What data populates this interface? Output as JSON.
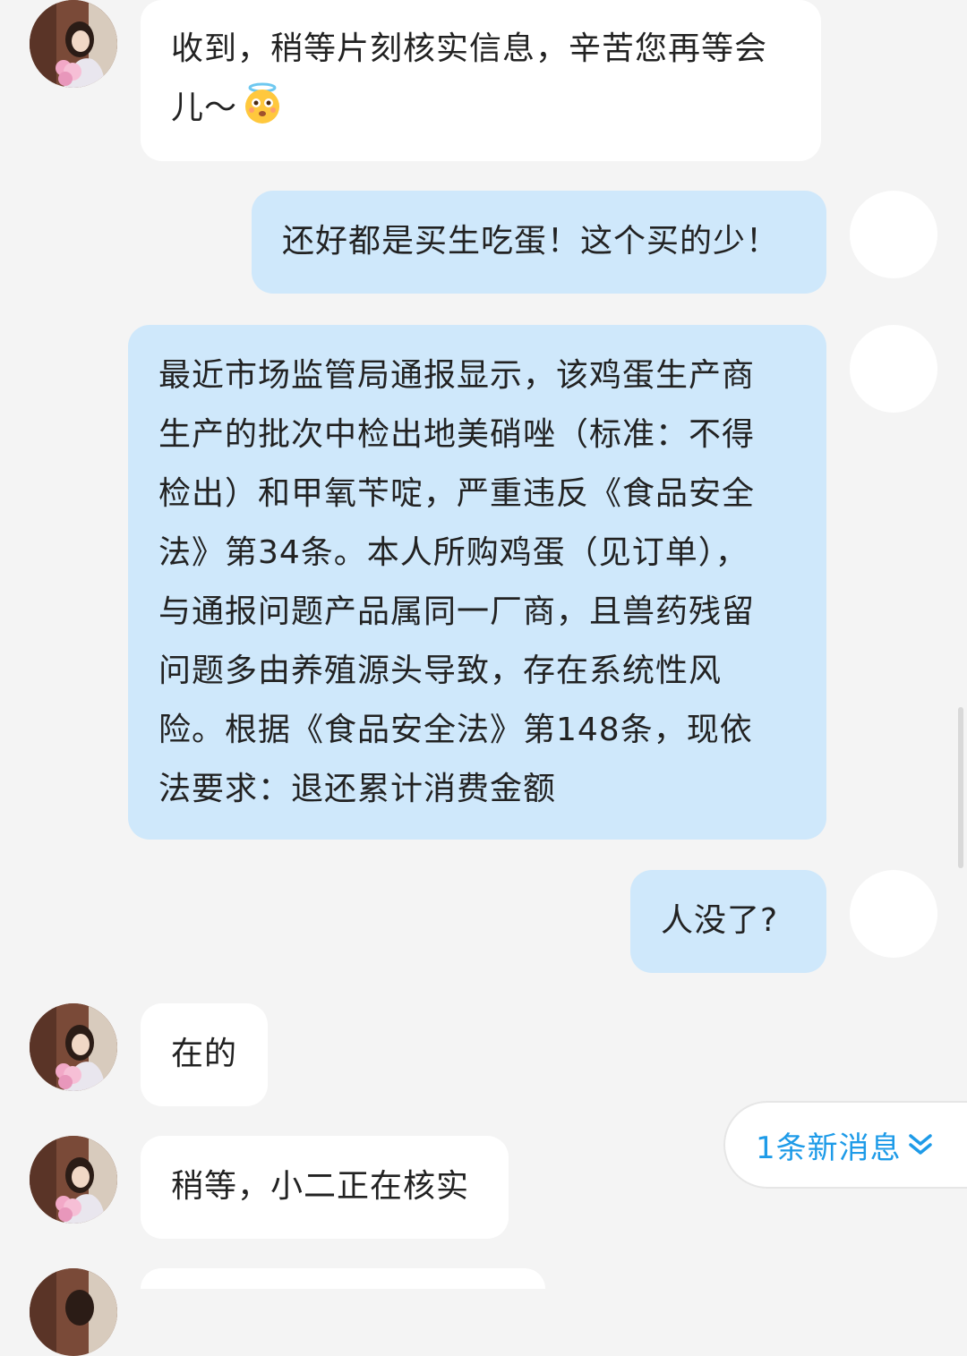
{
  "messages": [
    {
      "id": "m1",
      "side": "left",
      "text_line1": "收到，稍等片刻核实信息，辛苦您再等会",
      "text_line2": "儿～",
      "emoji": "angel-face-emoji"
    },
    {
      "id": "m2",
      "side": "right",
      "text": "还好都是买生吃蛋！这个买的少！"
    },
    {
      "id": "m3",
      "side": "right",
      "lines": [
        "最近市场监管局通报显示，该鸡蛋生产商",
        "生产的批次中检出地美硝唑（标准：不得",
        "检出）和甲氧苄啶，严重违反《食品安全",
        "法》第34条。本人所购鸡蛋（见订单），",
        "与通报问题产品属同一厂商，且兽药残留",
        "问题多由养殖源头导致，存在系统性风",
        "险。根据《食品安全法》第148条，现依",
        "法要求：退还累计消费金额"
      ]
    },
    {
      "id": "m4",
      "side": "right",
      "text": "人没了?"
    },
    {
      "id": "m5",
      "side": "left",
      "text": "在的"
    },
    {
      "id": "m6",
      "side": "left",
      "text": "稍等，小二正在核实"
    }
  ],
  "new_message_indicator": {
    "label": "1条新消息",
    "icon": "double-chevron-down-icon"
  },
  "colors": {
    "background": "#f4f4f4",
    "agent_bubble": "#ffffff",
    "user_bubble": "#cfe8fb",
    "accent": "#1e9be8"
  }
}
